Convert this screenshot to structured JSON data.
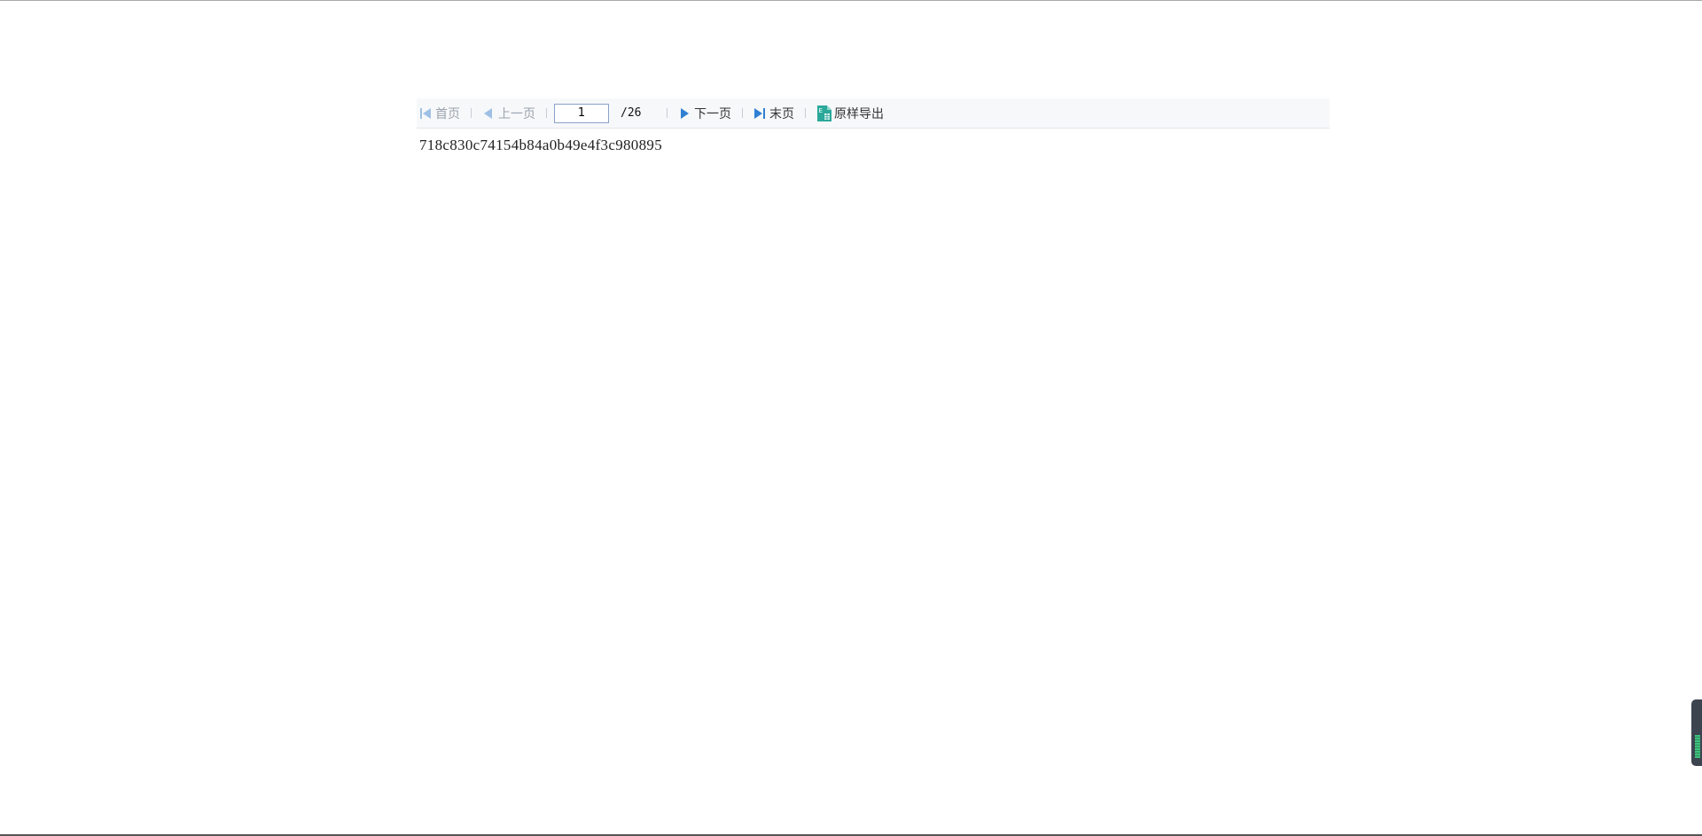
{
  "toolbar": {
    "first_label": "首页",
    "prev_label": "上一页",
    "current_page": "1",
    "total_pages": "/26",
    "next_label": "下一页",
    "last_label": "末页",
    "export_label": "原样导出",
    "export_icon_letter": "E"
  },
  "content": {
    "text": "718c830c74154b84a0b49e4f3c980895"
  },
  "colors": {
    "nav_icon_enabled": "#2f7fd2",
    "nav_icon_disabled": "#9fc0e4",
    "export_icon": "#2aa89a"
  },
  "icons": {
    "first": "first-page-icon",
    "prev": "prev-page-icon",
    "next": "next-page-icon",
    "last": "last-page-icon",
    "export": "export-excel-icon"
  }
}
